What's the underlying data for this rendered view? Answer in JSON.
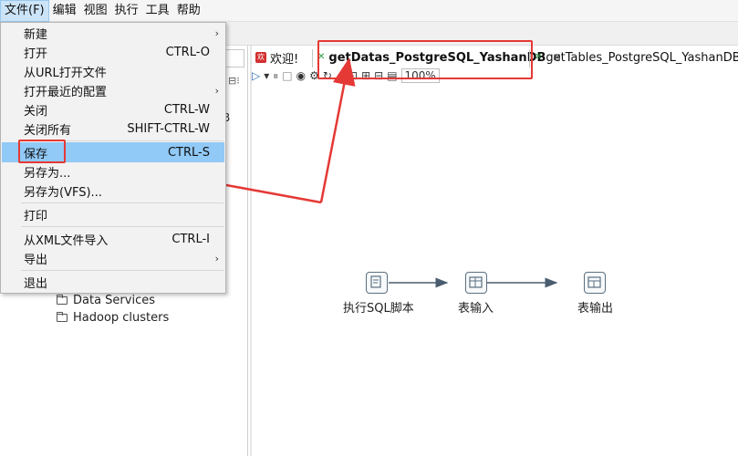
{
  "menubar": {
    "items": [
      "文件(F)",
      "编辑",
      "视图",
      "执行",
      "工具",
      "帮助"
    ]
  },
  "file_menu": {
    "items": [
      {
        "label": "新建",
        "shortcut": "",
        "submenu": true
      },
      {
        "label": "打开",
        "shortcut": "CTRL-O",
        "submenu": false
      },
      {
        "label": "从URL打开文件",
        "shortcut": "",
        "submenu": false
      },
      {
        "label": "打开最近的配置",
        "shortcut": "",
        "submenu": true
      },
      {
        "label": "关闭",
        "shortcut": "CTRL-W",
        "submenu": false
      },
      {
        "label": "关闭所有",
        "shortcut": "SHIFT-CTRL-W",
        "submenu": false
      },
      {
        "label": "保存",
        "shortcut": "CTRL-S",
        "submenu": false
      },
      {
        "label": "另存为...",
        "shortcut": "",
        "submenu": false
      },
      {
        "label": "另存为(VFS)...",
        "shortcut": "",
        "submenu": false
      },
      {
        "label": "打印",
        "shortcut": "",
        "submenu": false
      },
      {
        "label": "从XML文件导入",
        "shortcut": "CTRL-I",
        "submenu": false
      },
      {
        "label": "导出",
        "shortcut": "",
        "submenu": true
      },
      {
        "label": "退出",
        "shortcut": "",
        "submenu": false
      }
    ],
    "selected_label": "保存"
  },
  "left_panel": {
    "tree": [
      "Data Services",
      "Hadoop clusters"
    ],
    "partial_letter": "B"
  },
  "tabs": [
    {
      "label": "欢迎!",
      "icon": "welcome-icon"
    },
    {
      "label": "getDatas_PostgreSQL_YashanDB",
      "icon": "transformation-icon",
      "close": "⊠"
    },
    {
      "label": "getTables_PostgreSQL_YashanDB",
      "icon": "transformation-icon"
    }
  ],
  "editor_toolbar": {
    "zoom": "100%"
  },
  "flow": {
    "nodes": [
      {
        "label": "执行SQL脚本",
        "icon": "sql-script-icon"
      },
      {
        "label": "表输入",
        "icon": "table-input-icon"
      },
      {
        "label": "表输出",
        "icon": "table-output-icon"
      }
    ]
  },
  "colors": {
    "annotation_red": "#e53935",
    "menu_highlight": "#91c9f7",
    "hop_arrow": "#4a5d6e"
  }
}
